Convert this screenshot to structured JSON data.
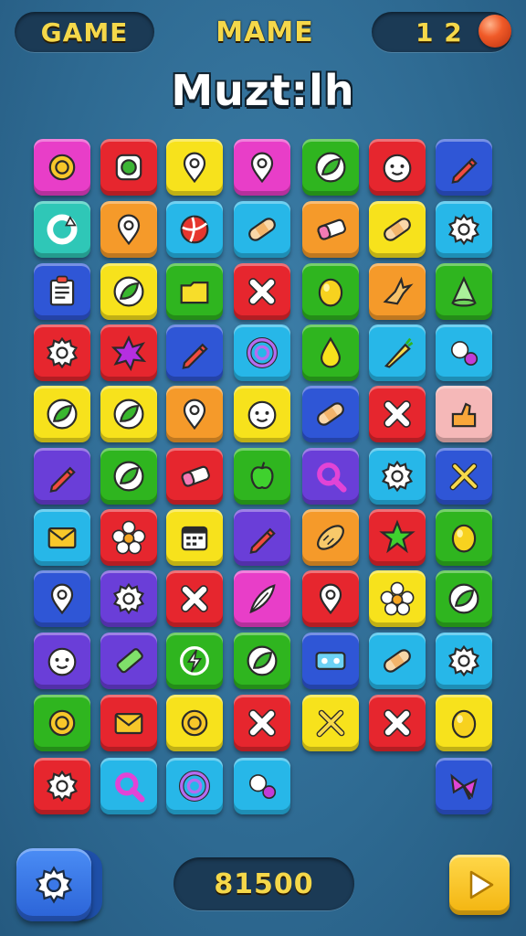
{
  "header": {
    "left_label": "GAME",
    "middle_label": "MAME",
    "counter": "1 2"
  },
  "title": "Muzt:lh",
  "footer": {
    "score": "81500"
  },
  "colors": {
    "magenta": "#e83ec8",
    "red": "#e6262e",
    "yellow": "#f7e21c",
    "green": "#2fb51f",
    "blue": "#2f56d6",
    "cyan": "#27b7e8",
    "orange": "#f59a2a",
    "teal": "#2fc7b7",
    "purple": "#6a3ed8",
    "pink": "#f5b8b8",
    "navy": "#1e3fbd"
  },
  "grid": {
    "rows": [
      [
        {
          "c": "magenta",
          "i": "ring-icon"
        },
        {
          "c": "red",
          "i": "gem-icon"
        },
        {
          "c": "yellow",
          "i": "map-pin-icon"
        },
        {
          "c": "magenta",
          "i": "map-pin-icon"
        },
        {
          "c": "green",
          "i": "leaf-icon"
        },
        {
          "c": "red",
          "i": "face-icon"
        },
        {
          "c": "blue",
          "i": "pencil-icon"
        }
      ],
      [
        {
          "c": "teal",
          "i": "refresh-icon"
        },
        {
          "c": "orange",
          "i": "map-pin-icon"
        },
        {
          "c": "cyan",
          "i": "ball-icon"
        },
        {
          "c": "cyan",
          "i": "bandage-icon"
        },
        {
          "c": "orange",
          "i": "eraser-icon"
        },
        {
          "c": "yellow",
          "i": "bandage-icon"
        },
        {
          "c": "cyan",
          "i": "gear-icon"
        }
      ],
      [
        {
          "c": "blue",
          "i": "document-icon"
        },
        {
          "c": "yellow",
          "i": "leaf-icon"
        },
        {
          "c": "green",
          "i": "folder-icon"
        },
        {
          "c": "red",
          "i": "close-icon"
        },
        {
          "c": "green",
          "i": "egg-icon"
        },
        {
          "c": "orange",
          "i": "bird-icon"
        },
        {
          "c": "green",
          "i": "cone-icon"
        }
      ],
      [
        {
          "c": "red",
          "i": "gear-icon"
        },
        {
          "c": "red",
          "i": "star-burst-icon"
        },
        {
          "c": "blue",
          "i": "pencil-icon"
        },
        {
          "c": "cyan",
          "i": "spiral-icon"
        },
        {
          "c": "green",
          "i": "drop-icon"
        },
        {
          "c": "cyan",
          "i": "carrot-icon"
        },
        {
          "c": "cyan",
          "i": "bubbles-icon"
        }
      ],
      [
        {
          "c": "yellow",
          "i": "leaf-icon"
        },
        {
          "c": "yellow",
          "i": "leaf-icon"
        },
        {
          "c": "orange",
          "i": "map-pin-icon"
        },
        {
          "c": "yellow",
          "i": "face-icon"
        },
        {
          "c": "blue",
          "i": "bandage-icon"
        },
        {
          "c": "red",
          "i": "close-icon"
        },
        {
          "c": "pink",
          "i": "hand-icon"
        }
      ],
      [
        {
          "c": "purple",
          "i": "pencil-icon"
        },
        {
          "c": "green",
          "i": "leaf-icon"
        },
        {
          "c": "red",
          "i": "eraser-icon"
        },
        {
          "c": "green",
          "i": "apple-icon"
        },
        {
          "c": "purple",
          "i": "magnifier-icon"
        },
        {
          "c": "cyan",
          "i": "gear-icon"
        },
        {
          "c": "blue",
          "i": "tools-icon"
        }
      ],
      [
        {
          "c": "cyan",
          "i": "envelope-icon"
        },
        {
          "c": "red",
          "i": "flower-icon"
        },
        {
          "c": "yellow",
          "i": "calendar-icon"
        },
        {
          "c": "purple",
          "i": "pencil-icon"
        },
        {
          "c": "orange",
          "i": "bread-icon"
        },
        {
          "c": "red",
          "i": "star-icon"
        },
        {
          "c": "green",
          "i": "egg-icon"
        }
      ],
      [
        {
          "c": "blue",
          "i": "map-pin-icon"
        },
        {
          "c": "purple",
          "i": "gear-icon"
        },
        {
          "c": "red",
          "i": "close-icon"
        },
        {
          "c": "magenta",
          "i": "feather-icon"
        },
        {
          "c": "red",
          "i": "map-pin-icon"
        },
        {
          "c": "yellow",
          "i": "flower-icon"
        },
        {
          "c": "green",
          "i": "leaf-icon"
        }
      ],
      [
        {
          "c": "purple",
          "i": "face-icon"
        },
        {
          "c": "purple",
          "i": "battery-icon"
        },
        {
          "c": "green",
          "i": "bolt-icon"
        },
        {
          "c": "green",
          "i": "leaf-icon"
        },
        {
          "c": "blue",
          "i": "tape-icon"
        },
        {
          "c": "cyan",
          "i": "bandage-icon"
        },
        {
          "c": "cyan",
          "i": "gear-icon"
        }
      ],
      [
        {
          "c": "green",
          "i": "ring-icon"
        },
        {
          "c": "red",
          "i": "envelope-icon"
        },
        {
          "c": "yellow",
          "i": "ring-icon"
        },
        {
          "c": "red",
          "i": "close-icon"
        },
        {
          "c": "yellow",
          "i": "tools-icon"
        },
        {
          "c": "red",
          "i": "close-icon"
        },
        {
          "c": "yellow",
          "i": "egg-icon"
        }
      ],
      [
        {
          "c": "red",
          "i": "gear-icon"
        },
        {
          "c": "cyan",
          "i": "magnifier-icon"
        },
        {
          "c": "cyan",
          "i": "spiral-icon"
        },
        {
          "c": "cyan",
          "i": "bubbles-icon"
        },
        null,
        null,
        {
          "c": "blue",
          "i": "bow-icon"
        }
      ]
    ]
  }
}
